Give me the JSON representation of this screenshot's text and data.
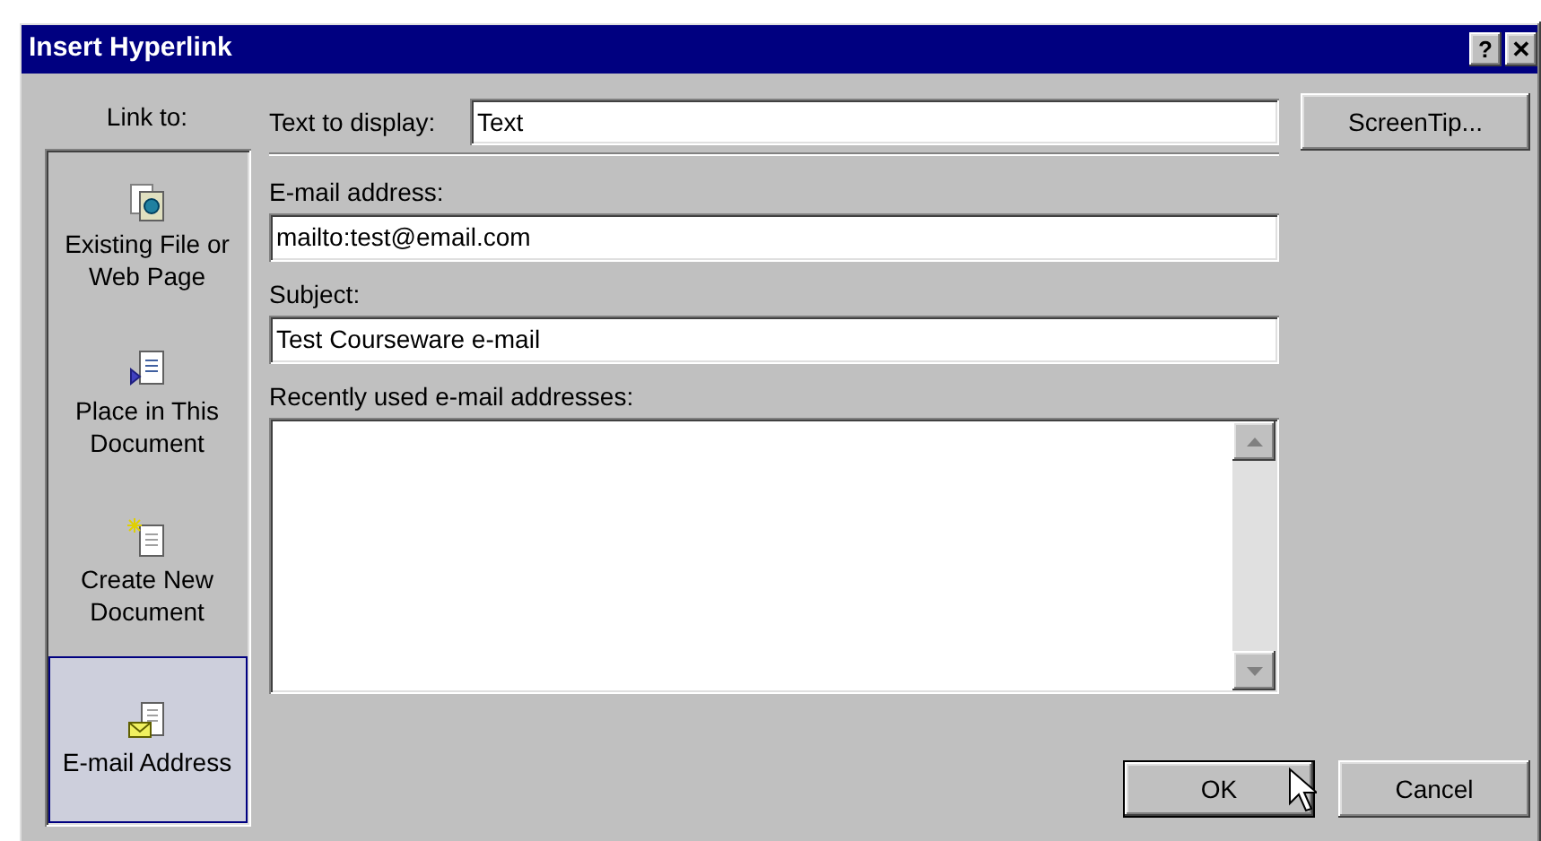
{
  "window": {
    "title": "Insert Hyperlink",
    "title_buttons": [
      "?",
      "✕"
    ]
  },
  "sidebar": {
    "label": "Link to:",
    "items": [
      {
        "label": "Existing File or Web Page",
        "kind": "file",
        "selected": false
      },
      {
        "label": "Place in This Document",
        "kind": "place",
        "selected": false
      },
      {
        "label": "Create New Document",
        "kind": "new",
        "selected": false
      },
      {
        "label": "E-mail Address",
        "kind": "email",
        "selected": true
      }
    ]
  },
  "text_to_display": {
    "label": "Text to display:",
    "value": "Text"
  },
  "screentip_button": "ScreenTip...",
  "email_address": {
    "label": "E-mail address:",
    "value": "mailto:test@email.com"
  },
  "subject": {
    "label": "Subject:",
    "value": "Test Courseware e-mail"
  },
  "recent_addresses": {
    "label": "Recently used e-mail addresses:"
  },
  "buttons": [
    {
      "label": "OK",
      "default": true
    },
    {
      "label": "Cancel",
      "default": false
    }
  ]
}
